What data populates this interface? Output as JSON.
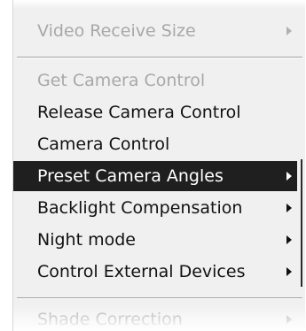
{
  "menu": {
    "items": [
      {
        "label": "Video Receive Size",
        "disabled": true,
        "has_submenu": true
      },
      {
        "label": "Get Camera Control",
        "disabled": true,
        "has_submenu": false
      },
      {
        "label": "Release Camera Control",
        "disabled": false,
        "has_submenu": false
      },
      {
        "label": "Camera Control",
        "disabled": false,
        "has_submenu": false
      },
      {
        "label": "Preset Camera Angles",
        "disabled": false,
        "has_submenu": true,
        "selected": true
      },
      {
        "label": "Backlight Compensation",
        "disabled": false,
        "has_submenu": true
      },
      {
        "label": "Night mode",
        "disabled": false,
        "has_submenu": true
      },
      {
        "label": "Control External Devices",
        "disabled": false,
        "has_submenu": true
      },
      {
        "label": "Shade Correction",
        "disabled": true,
        "has_submenu": true
      }
    ]
  },
  "icons": {
    "submenu_arrow": "chevron-right-icon"
  },
  "colors": {
    "menu_background": "#f0f0f0",
    "highlight": "#1f1f1f",
    "highlight_text": "#ffffff",
    "disabled_text": "#a8a8a8"
  }
}
